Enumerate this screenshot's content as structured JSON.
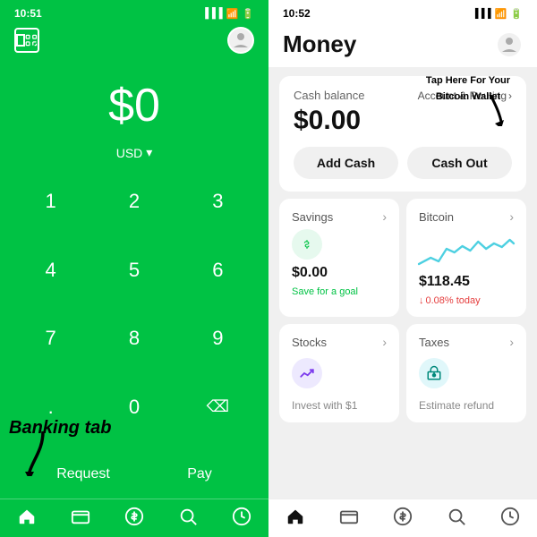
{
  "left": {
    "status_time": "10:51",
    "amount": "$0",
    "currency": "USD",
    "currency_arrow": "▾",
    "numpad": [
      "1",
      "2",
      "3",
      "4",
      "5",
      "6",
      "7",
      "8",
      "9",
      ".",
      "0",
      "‹"
    ],
    "request_label": "Request",
    "pay_label": "Pay",
    "nav_icons": [
      "home",
      "card",
      "dollar",
      "search",
      "clock"
    ],
    "banking_annotation": "Banking tab",
    "scan_icon": "⌗",
    "avatar_icon": "🌐"
  },
  "right": {
    "status_time": "10:52",
    "title": "Money",
    "cash_balance_label": "Cash balance",
    "account_routing_label": "Account & Routing",
    "cash_amount": "$0.00",
    "add_cash_label": "Add Cash",
    "cash_out_label": "Cash Out",
    "bitcoin_annotation": "Tap Here For Your Bitcoin Wallet",
    "savings": {
      "label": "Savings",
      "amount": "$0.00",
      "sub": "Save for a goal"
    },
    "bitcoin": {
      "label": "Bitcoin",
      "amount": "$118.45",
      "sub": "0.08% today",
      "change": "down"
    },
    "stocks": {
      "label": "Stocks",
      "sub": "Invest with $1"
    },
    "taxes": {
      "label": "Taxes",
      "sub": "Estimate refund"
    }
  }
}
